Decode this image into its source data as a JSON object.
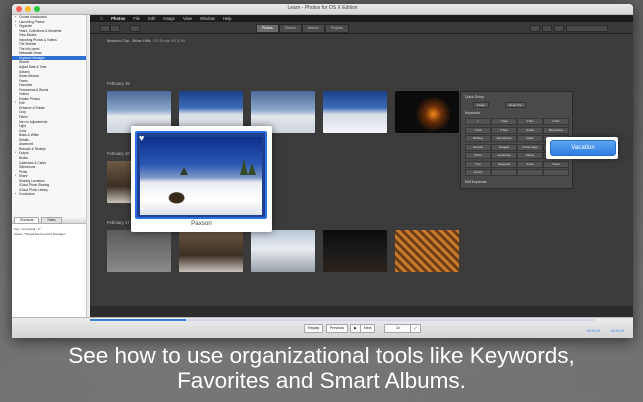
{
  "window": {
    "title": "Learn - Photos for OS X Edition"
  },
  "toc": {
    "items": [
      {
        "label": "Course Introduction",
        "level": 1,
        "open": false,
        "selected": false
      },
      {
        "label": "Launching Photos",
        "level": 1,
        "open": false,
        "selected": false
      },
      {
        "label": "Organize",
        "level": 1,
        "open": true,
        "selected": false
      },
      {
        "label": "Years, Collections & Moments",
        "level": 2,
        "selected": false
      },
      {
        "label": "View Modes",
        "level": 2,
        "selected": false
      },
      {
        "label": "Importing Photos & Videos",
        "level": 2,
        "selected": false
      },
      {
        "label": "The Sidebar",
        "level": 2,
        "selected": false
      },
      {
        "label": "The Info panel",
        "level": 2,
        "selected": false
      },
      {
        "label": "Metadata Views",
        "level": 2,
        "selected": false
      },
      {
        "label": "Keyword Manager",
        "level": 2,
        "selected": true
      },
      {
        "label": "Search",
        "level": 2,
        "selected": false
      },
      {
        "label": "Adjust Date & Time",
        "level": 2,
        "selected": false
      },
      {
        "label": "Albums",
        "level": 2,
        "selected": false
      },
      {
        "label": "Smart Albums",
        "level": 2,
        "selected": false
      },
      {
        "label": "Faces",
        "level": 2,
        "selected": false
      },
      {
        "label": "Favorites",
        "level": 2,
        "selected": false
      },
      {
        "label": "Panoramas & Bursts",
        "level": 2,
        "selected": false
      },
      {
        "label": "Videos",
        "level": 2,
        "selected": false
      },
      {
        "label": "Hidden Photos",
        "level": 2,
        "selected": false
      },
      {
        "label": "Edit",
        "level": 1,
        "open": true,
        "selected": false
      },
      {
        "label": "Enhance & Rotate",
        "level": 2,
        "selected": false
      },
      {
        "label": "Crop",
        "level": 2,
        "selected": false
      },
      {
        "label": "Filters",
        "level": 2,
        "selected": false
      },
      {
        "label": "Intro to Adjustments",
        "level": 2,
        "selected": false
      },
      {
        "label": "Light",
        "level": 2,
        "selected": false
      },
      {
        "label": "Color",
        "level": 2,
        "selected": false
      },
      {
        "label": "Black & White",
        "level": 2,
        "selected": false
      },
      {
        "label": "Details",
        "level": 2,
        "selected": false
      },
      {
        "label": "Advanced",
        "level": 2,
        "selected": false
      },
      {
        "label": "Retouch & Redeye",
        "level": 2,
        "selected": false
      },
      {
        "label": "Output",
        "level": 1,
        "open": true,
        "selected": false
      },
      {
        "label": "Books",
        "level": 2,
        "selected": false
      },
      {
        "label": "Calendars & Cards",
        "level": 2,
        "selected": false
      },
      {
        "label": "Slideshows",
        "level": 2,
        "selected": false
      },
      {
        "label": "Prints",
        "level": 2,
        "selected": false
      },
      {
        "label": "Share",
        "level": 1,
        "open": true,
        "selected": false
      },
      {
        "label": "Sharing Locations",
        "level": 2,
        "selected": false
      },
      {
        "label": "iCloud Photo Sharing",
        "level": 2,
        "selected": false
      },
      {
        "label": "iCloud Photo Library",
        "level": 2,
        "selected": false
      },
      {
        "label": "Conclusion",
        "level": 1,
        "open": false,
        "selected": false
      }
    ]
  },
  "notes_panel": {
    "tabs": [
      "Shortcuts",
      "Notes"
    ],
    "line1": "Key: \"command - K\"",
    "line2": "Action: \"Show/Hide Keyword Manager\""
  },
  "photos_app": {
    "menus": [
      "Photos",
      "File",
      "Edit",
      "Image",
      "View",
      "Window",
      "Help"
    ],
    "segments": [
      "Photos",
      "Shared",
      "Albums",
      "Projects"
    ],
    "selected_segment": "Photos",
    "breadcrumb_place": "Maxson City - Brian Hills",
    "breadcrumb_rest": "US Route 50 & 89",
    "date_headers": [
      "February 15",
      "February 16",
      "February 17"
    ],
    "more_label": "Maxson City - Brian Hills"
  },
  "keyword_panel": {
    "quick_group": "Quick Group",
    "sub_left": "Close",
    "sub_right": "Road Trip",
    "keywords_title": "Keywords",
    "keywords": [
      "✓",
      "1 Star",
      "2 Star",
      "3 Star",
      "4 Star",
      "5 Star",
      "Drafts",
      "Big Adeline",
      "Birthday",
      "Gail Shrews",
      "Gatlin",
      "Family",
      "Favorite",
      "Flagged",
      "Crows Sage",
      "Kids",
      "Photo",
      "Landscape",
      "Nature",
      "Pan",
      "Tree",
      "Seasonal",
      "Snow",
      "Travel",
      "Vehicle",
      "",
      "",
      ""
    ],
    "edit_label": "Edit Keywords"
  },
  "vacation_button": {
    "label": "Vacation"
  },
  "card": {
    "caption": "Paxson"
  },
  "videobar": {
    "replay": "Replay",
    "previous": "Previous",
    "next": "Next",
    "speed": "1x",
    "time_left": "00:00:15",
    "time_right": "-00:01:29",
    "progress": 0.19
  },
  "promo": {
    "line1": "See how to use organizational tools like Keywords,",
    "line2": "Favorites and Smart Albums."
  },
  "colors": {
    "accent": "#2f7fe0",
    "highlight": "#2a6fe6",
    "background": "#6b6b6b"
  }
}
